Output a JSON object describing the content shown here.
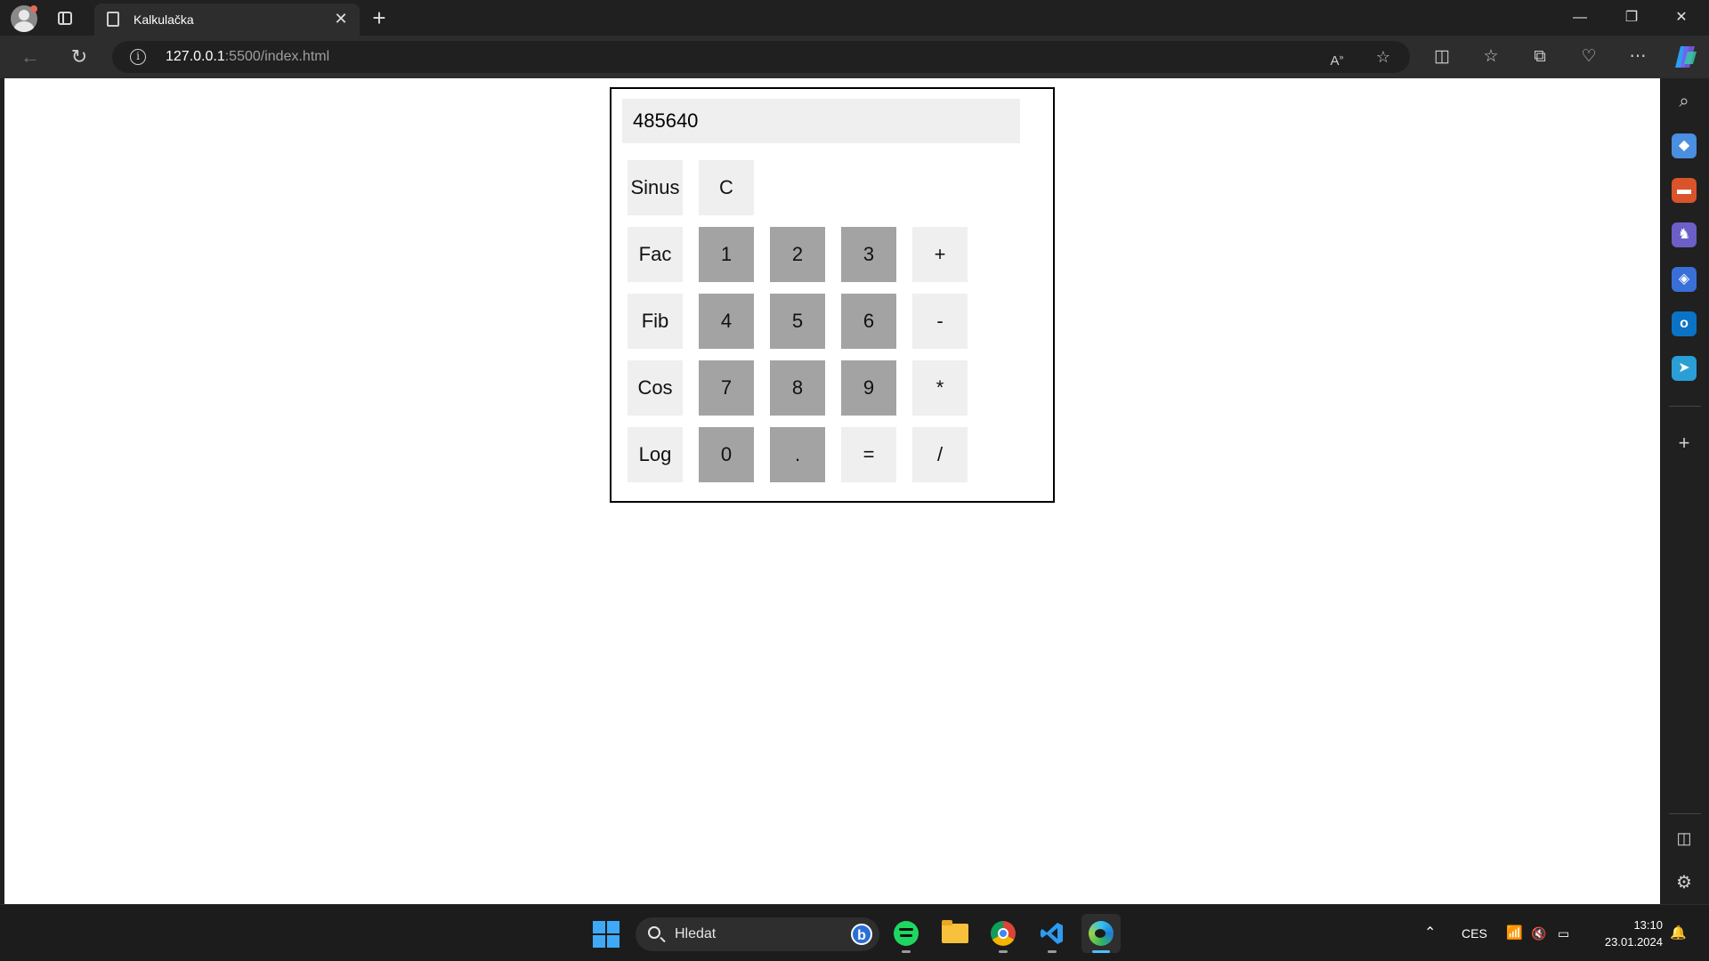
{
  "browser": {
    "tab_title": "Kalkulačka",
    "tab_close": "✕",
    "new_tab": "+",
    "url_host": "127.0.0.1",
    "url_rest": ":5500/index.html",
    "window": {
      "minimize": "—",
      "maximize": "❐",
      "close": "✕"
    }
  },
  "calculator": {
    "display_value": "485640",
    "keys": {
      "sinus": "Sinus",
      "clear": "C",
      "fac": "Fac",
      "k1": "1",
      "k2": "2",
      "k3": "3",
      "plus": "+",
      "fib": "Fib",
      "k4": "4",
      "k5": "5",
      "k6": "6",
      "minus": "-",
      "cos": "Cos",
      "k7": "7",
      "k8": "8",
      "k9": "9",
      "multiply": "*",
      "log": "Log",
      "k0": "0",
      "dot": ".",
      "equals": "=",
      "divide": "/"
    }
  },
  "taskbar": {
    "search_placeholder": "Hledat",
    "language": "CES",
    "time": "13:10",
    "date": "23.01.2024"
  }
}
